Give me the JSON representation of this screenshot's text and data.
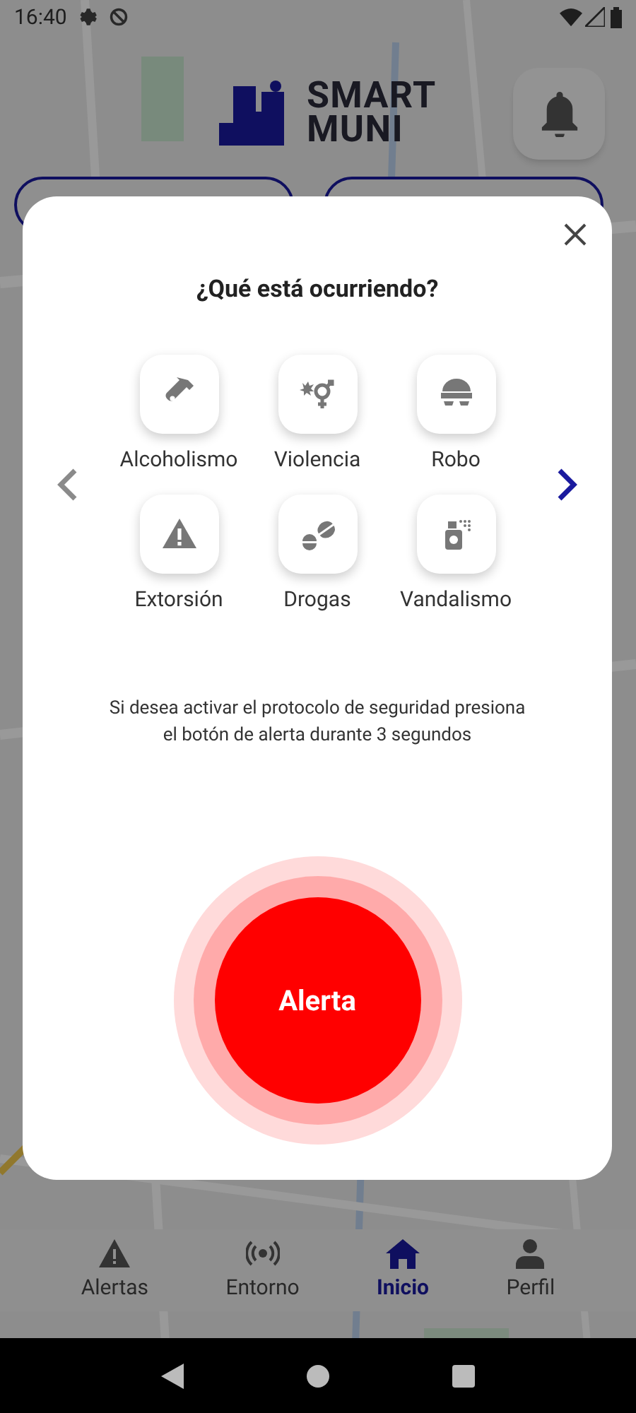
{
  "status_bar": {
    "time": "16:40"
  },
  "header": {
    "logo_lines": [
      "SMART",
      "MUNI"
    ]
  },
  "bottom_nav": [
    {
      "label": "Alertas",
      "kind": "warning",
      "selected": false
    },
    {
      "label": "Entorno",
      "kind": "signal",
      "selected": false
    },
    {
      "label": "Inicio",
      "kind": "home",
      "selected": true
    },
    {
      "label": "Perfil",
      "kind": "person",
      "selected": false
    }
  ],
  "dialog": {
    "title": "¿Qué está ocurriendo?",
    "categories": [
      {
        "label": "Alcoholismo",
        "kind": "bottle"
      },
      {
        "label": "Violencia",
        "kind": "gender"
      },
      {
        "label": "Robo",
        "kind": "thief"
      },
      {
        "label": "Extorsión",
        "kind": "warning"
      },
      {
        "label": "Drogas",
        "kind": "pills"
      },
      {
        "label": "Vandalismo",
        "kind": "spray"
      }
    ],
    "prev_arrow": {
      "disabled": true
    },
    "next_arrow": {
      "disabled": false
    },
    "instruction": "Si desea activar el protocolo de seguridad presiona el botón de alerta durante 3 segundos",
    "alert_button": "Alerta"
  }
}
